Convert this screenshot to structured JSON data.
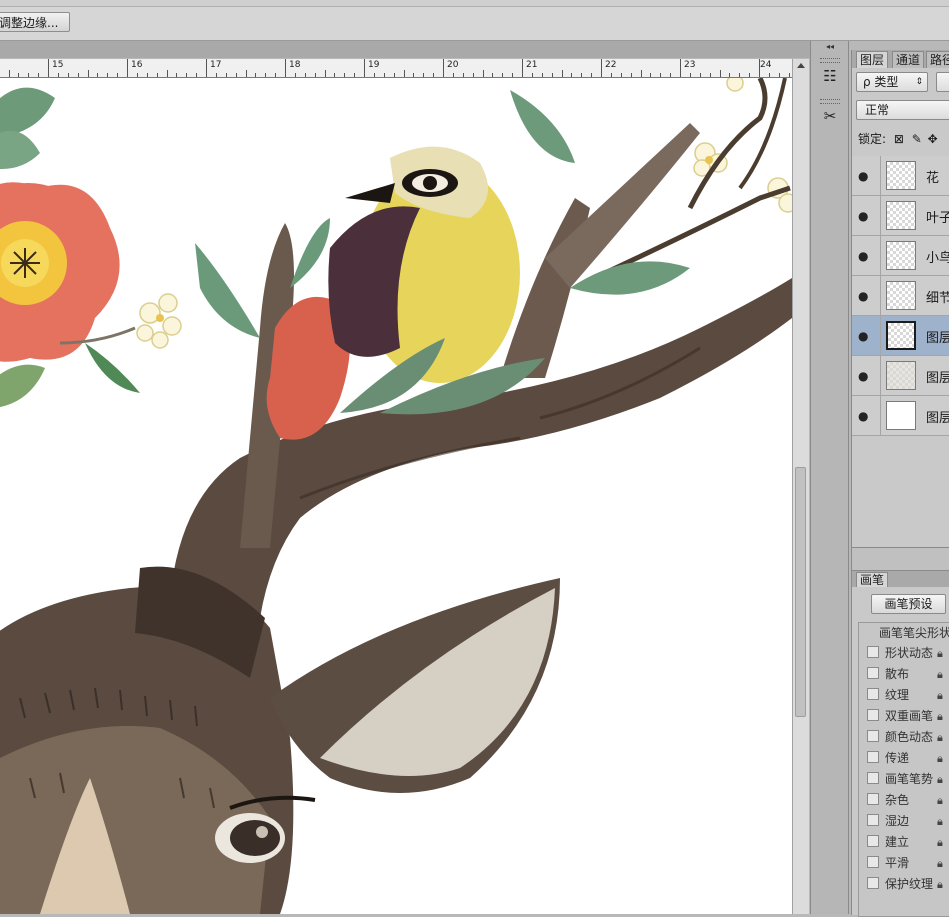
{
  "options_bar": {
    "refine_edge_label": "调整边缘..."
  },
  "ruler": {
    "labels": [
      "15",
      "16",
      "17",
      "18",
      "19",
      "20",
      "21",
      "22",
      "23",
      "24"
    ]
  },
  "layers_panel": {
    "tabs": [
      "图层",
      "通道",
      "路径"
    ],
    "filter_label": "ρ 类型",
    "blend_mode": "正常",
    "lock_label": "锁定:",
    "layers": [
      {
        "name": "花",
        "visible": true,
        "selected": false
      },
      {
        "name": "叶子",
        "visible": true,
        "selected": false
      },
      {
        "name": "小鸟",
        "visible": true,
        "selected": false
      },
      {
        "name": "细节",
        "visible": true,
        "selected": false
      },
      {
        "name": "图层",
        "visible": true,
        "selected": true
      },
      {
        "name": "图层",
        "visible": true,
        "selected": false
      },
      {
        "name": "图层",
        "visible": true,
        "selected": false
      }
    ]
  },
  "brush_panel": {
    "tab": "画笔",
    "preset_button": "画笔预设",
    "header": "画笔笔尖形状",
    "options": [
      "形状动态",
      "散布",
      "纹理",
      "双重画笔",
      "颜色动态",
      "传递",
      "画笔笔势",
      "杂色",
      "湿边",
      "建立",
      "平滑",
      "保护纹理"
    ]
  },
  "colors": {
    "canvas": "#ffffff",
    "panel": "#c9c9c9",
    "selected_layer": "#9fb2cc"
  }
}
